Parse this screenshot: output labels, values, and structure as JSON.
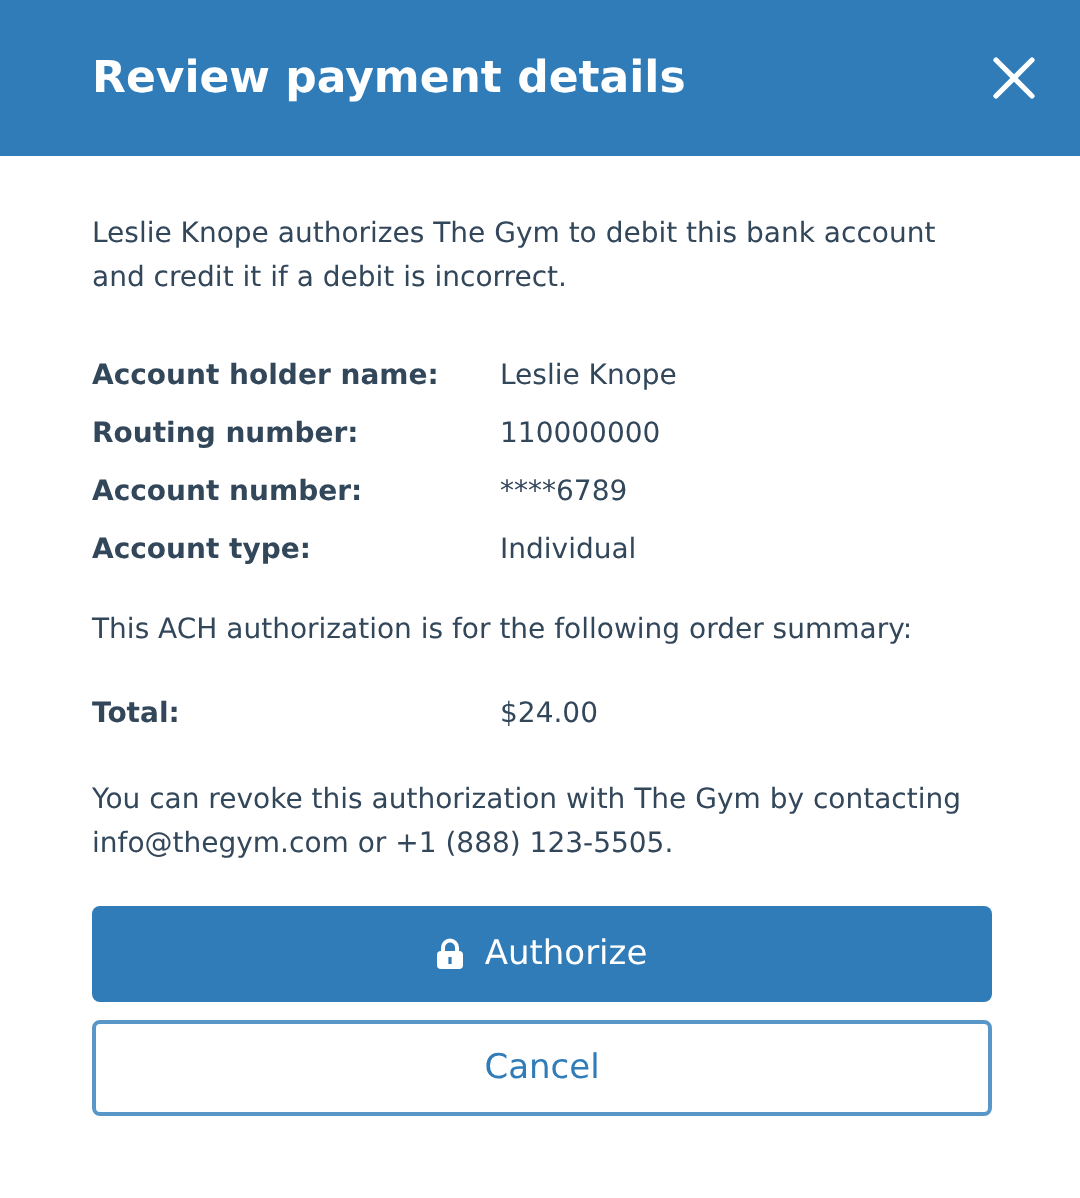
{
  "header": {
    "title": "Review payment details"
  },
  "intro": "Leslie Knope authorizes The Gym to debit this bank account and credit it if a debit is incorrect.",
  "details": [
    {
      "label": "Account holder name:",
      "value": "Leslie Knope"
    },
    {
      "label": "Routing number:",
      "value": "110000000"
    },
    {
      "label": "Account number:",
      "value": "****6789"
    },
    {
      "label": "Account type:",
      "value": "Individual"
    }
  ],
  "summary_note": "This ACH authorization is for the following order summary:",
  "total": {
    "label": "Total:",
    "value": "$24.00"
  },
  "revoke_note": "You can revoke this authorization with The Gym by contacting info@thegym.com or +1 (888) 123-5505.",
  "buttons": [
    {
      "label": "Authorize",
      "kind": "primary"
    },
    {
      "label": "Cancel",
      "kind": "secondary"
    }
  ]
}
